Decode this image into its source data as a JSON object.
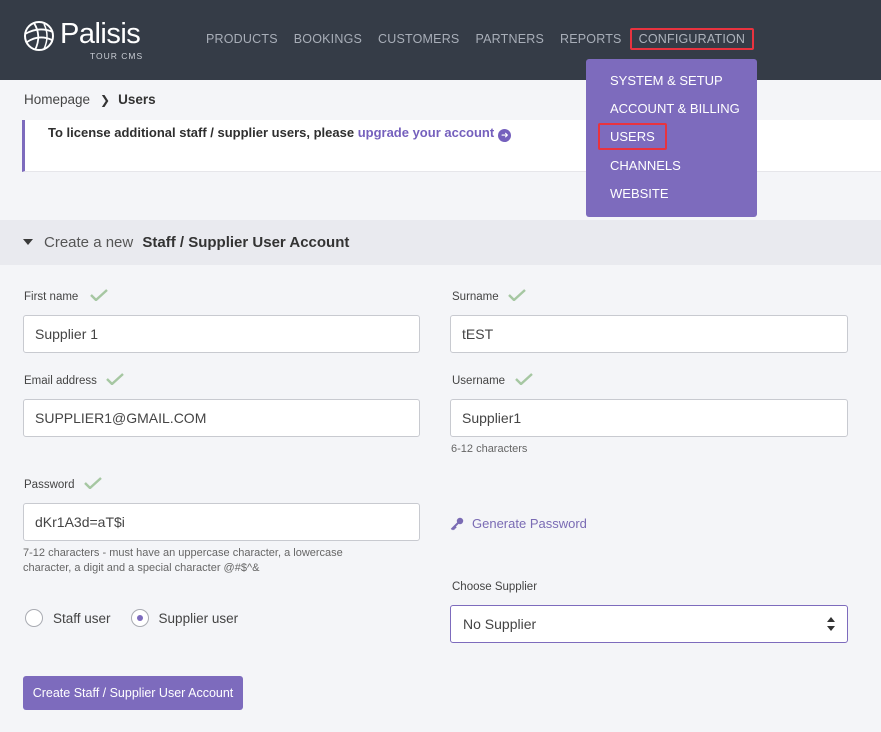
{
  "brand": {
    "name": "Palisis",
    "subtitle": "TOUR CMS"
  },
  "nav": {
    "items": [
      {
        "label": "PRODUCTS"
      },
      {
        "label": "BOOKINGS"
      },
      {
        "label": "CUSTOMERS"
      },
      {
        "label": "PARTNERS"
      },
      {
        "label": "REPORTS"
      },
      {
        "label": "CONFIGURATION"
      }
    ]
  },
  "config_menu": {
    "items": [
      {
        "label": "SYSTEM & SETUP"
      },
      {
        "label": "ACCOUNT & BILLING"
      },
      {
        "label": "USERS"
      },
      {
        "label": "CHANNELS"
      },
      {
        "label": "WEBSITE"
      }
    ]
  },
  "breadcrumb": {
    "home": "Homepage",
    "current": "Users"
  },
  "notice": {
    "text": "To license additional staff / supplier users, please ",
    "link": "upgrade your account"
  },
  "section": {
    "prefix": "Create a new",
    "title": "Staff / Supplier User Account"
  },
  "form": {
    "first_name": {
      "label": "First name",
      "value": "Supplier 1"
    },
    "surname": {
      "label": "Surname",
      "value": "tEST"
    },
    "email": {
      "label": "Email address",
      "value": "SUPPLIER1@GMAIL.COM"
    },
    "username": {
      "label": "Username",
      "value": "Supplier1",
      "hint": "6-12 characters"
    },
    "password": {
      "label": "Password",
      "value": "dKr1A3d=aT$i",
      "hint_line1": "7-12 characters - must have an uppercase character, a lowercase",
      "hint_line2": "character, a digit and a special character @#$^&"
    },
    "generate_password": "Generate Password",
    "user_type": {
      "options": [
        {
          "label": "Staff user",
          "selected": false
        },
        {
          "label": "Supplier user",
          "selected": true
        }
      ]
    },
    "supplier": {
      "label": "Choose Supplier",
      "value": "No Supplier"
    },
    "submit_label": "Create Staff / Supplier User Account"
  },
  "colors": {
    "accent": "#7d6bbd",
    "header_bg": "#353c47",
    "highlight": "#e8333f",
    "check": "#a6c7a2"
  }
}
